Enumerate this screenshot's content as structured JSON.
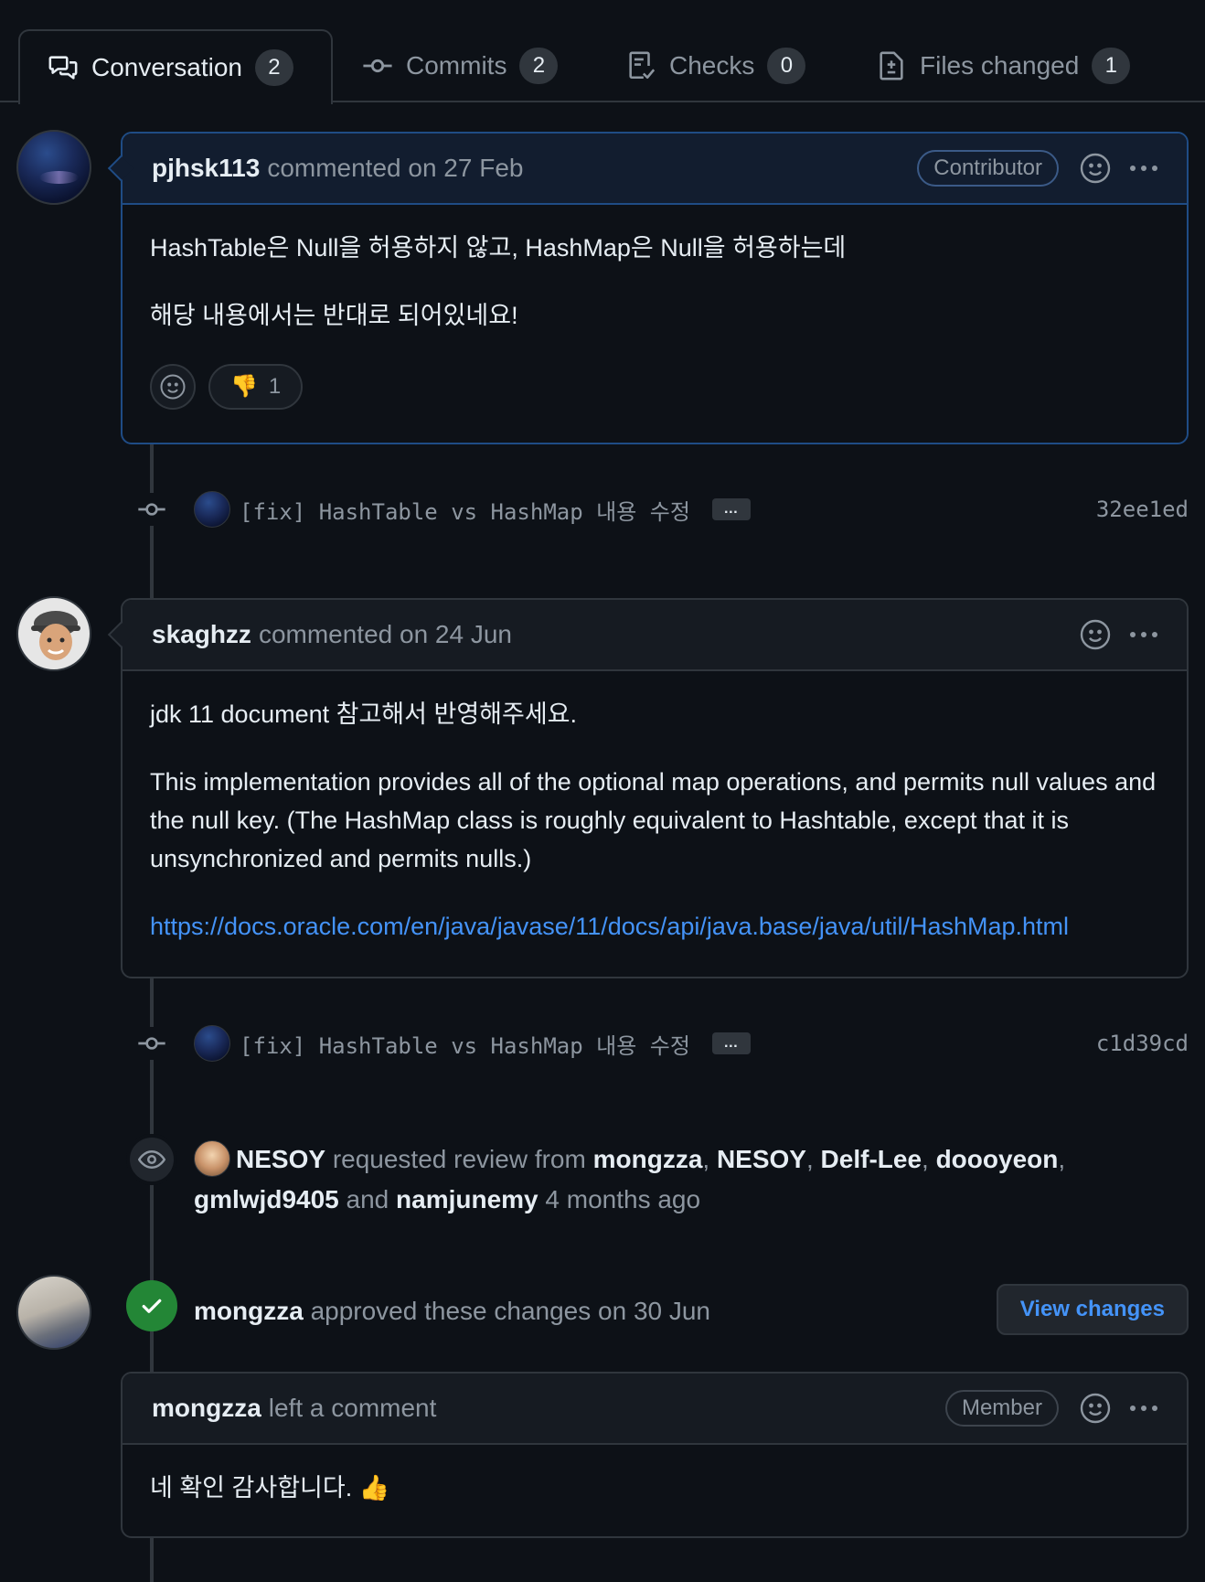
{
  "tabs": [
    {
      "label": "Conversation",
      "count": "2",
      "icon": "comment-discussion-icon"
    },
    {
      "label": "Commits",
      "count": "2",
      "icon": "git-commit-icon"
    },
    {
      "label": "Checks",
      "count": "0",
      "icon": "checklist-icon"
    },
    {
      "label": "Files changed",
      "count": "1",
      "icon": "file-diff-icon"
    }
  ],
  "comment1": {
    "author": "pjhsk113",
    "meta": "commented on 27 Feb",
    "badge": "Contributor",
    "paragraphs": [
      "HashTable은 Null을 허용하지 않고, HashMap은 Null을 허용하는데",
      "해당 내용에서는 반대로 되어있네요!"
    ],
    "reaction_emoji": "👎",
    "reaction_count": "1"
  },
  "commit1": {
    "message": "[fix] HashTable vs HashMap 내용 수정",
    "sha": "32ee1ed",
    "ellipsis": "…"
  },
  "comment2": {
    "author": "skaghzz",
    "meta": "commented on 24 Jun",
    "paragraphs": [
      "jdk 11 document 참고해서 반영해주세요.",
      "This implementation provides all of the optional map operations, and permits null values and the null key. (The HashMap class is roughly equivalent to Hashtable, except that it is unsynchronized and permits nulls.)"
    ],
    "link": "https://docs.oracle.com/en/java/javase/11/docs/api/java.base/java/util/HashMap.html"
  },
  "commit2": {
    "message": "[fix] HashTable vs HashMap 내용 수정",
    "sha": "c1d39cd",
    "ellipsis": "…"
  },
  "review_request": {
    "actor": "NESOY",
    "text1": "requested review from",
    "reviewers": [
      "mongzza",
      "NESOY",
      "Delf-Lee",
      "doooyeon",
      "gmlwjd9405",
      "namjunemy"
    ],
    "sep": ",",
    "and": "and",
    "time": "4 months ago"
  },
  "approval": {
    "author": "mongzza",
    "text": "approved these changes on 30 Jun",
    "button": "View changes"
  },
  "comment3": {
    "author": "mongzza",
    "meta": "left a comment",
    "badge": "Member",
    "paragraph": "네 확인 감사합니다. 👍"
  },
  "colors": {
    "background": "#0d1117",
    "border": "#30363d",
    "link": "#4493f8",
    "success": "#238636"
  }
}
